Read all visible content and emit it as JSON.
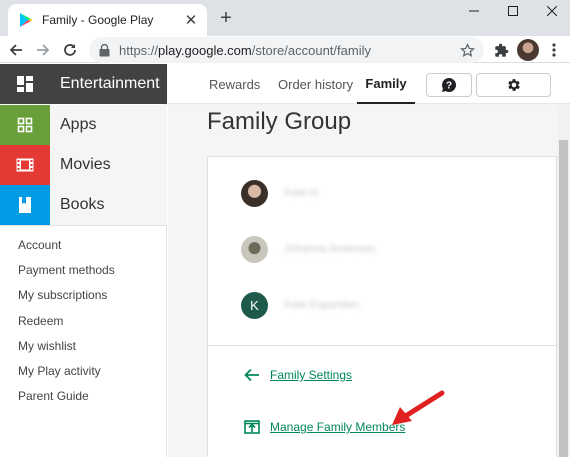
{
  "browser": {
    "tab_title": "Family - Google Play",
    "url_host": "play.google.com",
    "url_path": "/store/account/family",
    "url_scheme": "https://"
  },
  "sidebar": {
    "categories": [
      {
        "label": "Entertainment",
        "color": "#424242"
      },
      {
        "label": "Apps",
        "color": "#689f38"
      },
      {
        "label": "Movies",
        "color": "#e53935"
      },
      {
        "label": "Books",
        "color": "#039be5"
      }
    ],
    "links": [
      "Account",
      "Payment methods",
      "My subscriptions",
      "Redeem",
      "My wishlist",
      "My Play activity",
      "Parent Guide"
    ]
  },
  "topnav": {
    "tabs": [
      {
        "label": "Rewards"
      },
      {
        "label": "Order history"
      },
      {
        "label": "Family"
      }
    ],
    "active_tab": "Family"
  },
  "main": {
    "title": "Family Group",
    "members": [
      {
        "name": "Kate H.",
        "avatar": "photo"
      },
      {
        "name": "Johanna Anderson",
        "avatar": "photo"
      },
      {
        "name": "Kate Espanden",
        "avatar_letter": "K",
        "avatar_color": "#1e5a4c"
      }
    ],
    "links": {
      "family_settings": "Family Settings",
      "manage_members": "Manage Family Members"
    }
  },
  "colors": {
    "link": "#01875f",
    "annotation_arrow": "#e02020"
  }
}
